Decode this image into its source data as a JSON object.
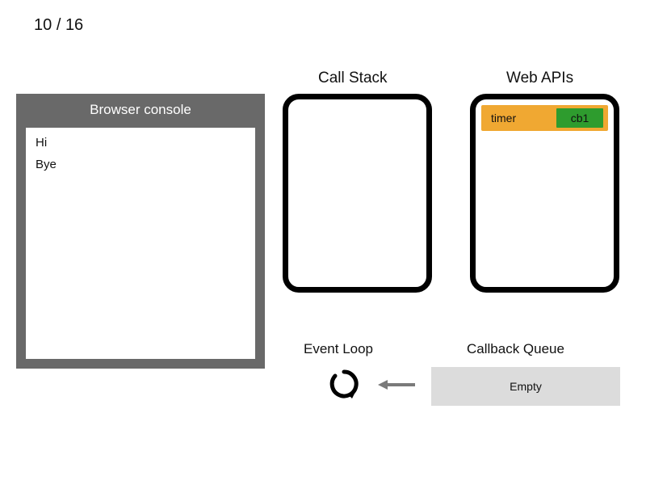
{
  "step": {
    "current": "10",
    "separator": "/",
    "total": "16"
  },
  "console": {
    "title": "Browser console",
    "lines": [
      "Hi",
      "Bye"
    ]
  },
  "stack": {
    "title": "Call Stack",
    "items": []
  },
  "apis": {
    "title": "Web APIs",
    "items": [
      {
        "label": "timer",
        "callback": "cb1"
      }
    ]
  },
  "loop": {
    "title": "Event Loop"
  },
  "queue": {
    "title": "Callback Queue",
    "empty_label": "Empty"
  }
}
